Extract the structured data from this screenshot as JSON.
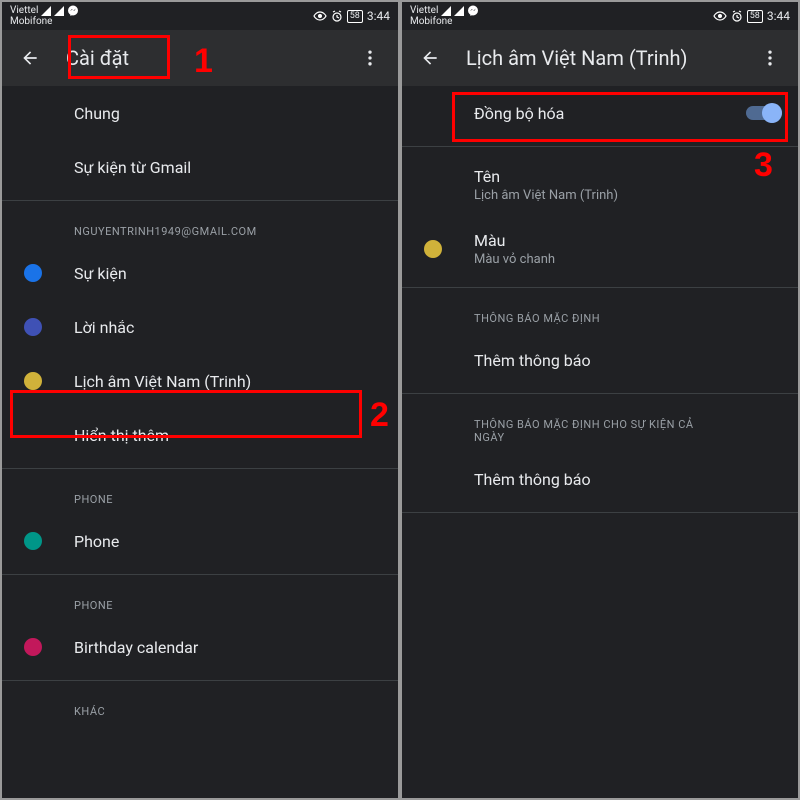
{
  "statusbar": {
    "carrier1": "Viettel",
    "carrier2": "Mobifone",
    "time": "3:44",
    "battery": "58",
    "icons": {
      "signal": "signal-icon",
      "messenger": "messenger-icon",
      "eye": "eye-icon",
      "alarm": "alarm-icon"
    }
  },
  "left": {
    "title": "Cài đặt",
    "items_general": [
      {
        "label": "Chung"
      },
      {
        "label": "Sự kiện từ Gmail"
      }
    ],
    "account_header": "NGUYENTRINH1949@GMAIL.COM",
    "account_items": [
      {
        "label": "Sự kiện",
        "color": "#1a73e8"
      },
      {
        "label": "Lời nhắc",
        "color": "#3f51b5"
      },
      {
        "label": "Lịch âm Việt Nam (Trinh)",
        "color": "#d0b23a"
      },
      {
        "label": "Hiển thị thêm"
      }
    ],
    "phone_header1": "PHONE",
    "phone_items1": [
      {
        "label": "Phone",
        "color": "#009688"
      }
    ],
    "phone_header2": "PHONE",
    "phone_items2": [
      {
        "label": "Birthday calendar",
        "color": "#c2185b"
      }
    ],
    "other_header": "KHÁC"
  },
  "right": {
    "title": "Lịch âm Việt Nam (Trinh)",
    "sync": {
      "label": "Đồng bộ hóa",
      "on": true
    },
    "name_item": {
      "title": "Tên",
      "sub": "Lịch âm Việt Nam (Trinh)"
    },
    "color_item": {
      "title": "Màu",
      "sub": "Màu vỏ chanh",
      "color": "#d0b23a"
    },
    "notif_header1": "THÔNG BÁO MẶC ĐỊNH",
    "notif_add1": "Thêm thông báo",
    "notif_header2": "THÔNG BÁO MẶC ĐỊNH CHO SỰ KIỆN CẢ NGÀY",
    "notif_add2": "Thêm thông báo"
  },
  "annotations": {
    "n1": "1",
    "n2": "2",
    "n3": "3"
  }
}
